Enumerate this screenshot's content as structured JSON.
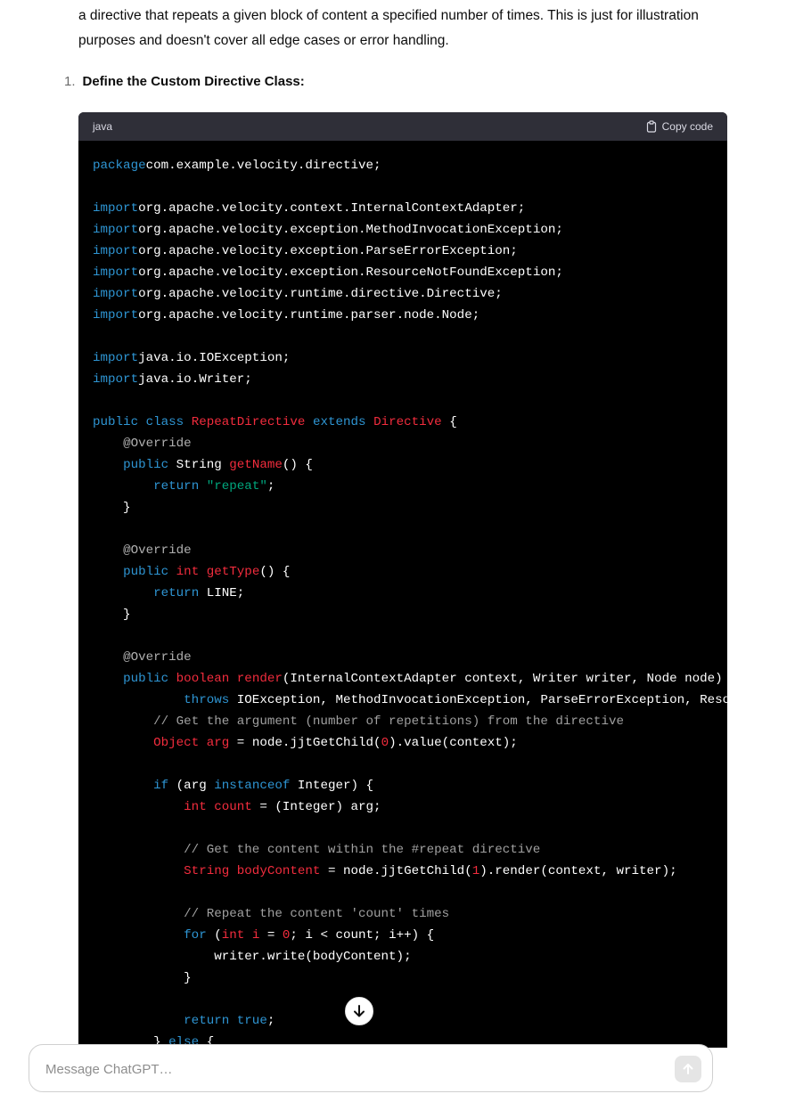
{
  "intro_text": "a directive that repeats a given block of content a specified number of times. This is just for illustration purposes and doesn't cover all edge cases or error handling.",
  "step": {
    "number": "1.",
    "label": "Define the Custom Directive Class:"
  },
  "code_block": {
    "language": "java",
    "copy_label": "Copy code",
    "lines": [
      [
        [
          "kw",
          "package"
        ],
        [
          "",
          "com.example.velocity.directive;"
        ]
      ],
      [],
      [
        [
          "kw",
          "import"
        ],
        [
          "",
          "org.apache.velocity.context.InternalContextAdapter;"
        ]
      ],
      [
        [
          "kw",
          "import"
        ],
        [
          "",
          "org.apache.velocity.exception.MethodInvocationException;"
        ]
      ],
      [
        [
          "kw",
          "import"
        ],
        [
          "",
          "org.apache.velocity.exception.ParseErrorException;"
        ]
      ],
      [
        [
          "kw",
          "import"
        ],
        [
          "",
          "org.apache.velocity.exception.ResourceNotFoundException;"
        ]
      ],
      [
        [
          "kw",
          "import"
        ],
        [
          "",
          "org.apache.velocity.runtime.directive.Directive;"
        ]
      ],
      [
        [
          "kw",
          "import"
        ],
        [
          "",
          "org.apache.velocity.runtime.parser.node.Node;"
        ]
      ],
      [],
      [
        [
          "kw",
          "import"
        ],
        [
          "",
          "java.io.IOException;"
        ]
      ],
      [
        [
          "kw",
          "import"
        ],
        [
          "",
          "java.io.Writer;"
        ]
      ],
      [],
      [
        [
          "kw",
          "public"
        ],
        [
          "",
          " "
        ],
        [
          "kw",
          "class"
        ],
        [
          "",
          " "
        ],
        [
          "ty",
          "RepeatDirective"
        ],
        [
          "",
          " "
        ],
        [
          "kw",
          "extends"
        ],
        [
          "",
          " "
        ],
        [
          "ty",
          "Directive"
        ],
        [
          "",
          " {"
        ]
      ],
      [
        [
          "",
          "    "
        ],
        [
          "an",
          "@Override"
        ]
      ],
      [
        [
          "",
          "    "
        ],
        [
          "kw",
          "public"
        ],
        [
          "",
          " String "
        ],
        [
          "ty",
          "getName"
        ],
        [
          "",
          "() {"
        ]
      ],
      [
        [
          "",
          "        "
        ],
        [
          "kw",
          "return"
        ],
        [
          "",
          " "
        ],
        [
          "str",
          "\"repeat\""
        ],
        [
          "",
          ";"
        ]
      ],
      [
        [
          "",
          "    }"
        ]
      ],
      [],
      [
        [
          "",
          "    "
        ],
        [
          "an",
          "@Override"
        ]
      ],
      [
        [
          "",
          "    "
        ],
        [
          "kw",
          "public"
        ],
        [
          "",
          " "
        ],
        [
          "ty",
          "int"
        ],
        [
          "",
          " "
        ],
        [
          "ty",
          "getType"
        ],
        [
          "",
          "() {"
        ]
      ],
      [
        [
          "",
          "        "
        ],
        [
          "kw",
          "return"
        ],
        [
          "",
          " LINE;"
        ]
      ],
      [
        [
          "",
          "    }"
        ]
      ],
      [],
      [
        [
          "",
          "    "
        ],
        [
          "an",
          "@Override"
        ]
      ],
      [
        [
          "",
          "    "
        ],
        [
          "kw",
          "public"
        ],
        [
          "",
          " "
        ],
        [
          "ty",
          "boolean"
        ],
        [
          "",
          " "
        ],
        [
          "ty",
          "render"
        ],
        [
          "",
          "(InternalContextAdapter context, Writer writer, Node node)"
        ]
      ],
      [
        [
          "",
          "            "
        ],
        [
          "kw",
          "throws"
        ],
        [
          "",
          " IOException, MethodInvocationException, ParseErrorException, ResourceNotFoundException {"
        ]
      ],
      [
        [
          "",
          "        "
        ],
        [
          "cm",
          "// Get the argument (number of repetitions) from the directive"
        ]
      ],
      [
        [
          "",
          "        "
        ],
        [
          "ty",
          "Object"
        ],
        [
          "",
          " "
        ],
        [
          "ty",
          "arg"
        ],
        [
          "",
          " = node.jjtGetChild("
        ],
        [
          "ty",
          "0"
        ],
        [
          "",
          ").value(context);"
        ]
      ],
      [],
      [
        [
          "",
          "        "
        ],
        [
          "kw",
          "if"
        ],
        [
          "",
          " (arg "
        ],
        [
          "kw",
          "instanceof"
        ],
        [
          "",
          " Integer) {"
        ]
      ],
      [
        [
          "",
          "            "
        ],
        [
          "ty",
          "int"
        ],
        [
          "",
          " "
        ],
        [
          "ty",
          "count"
        ],
        [
          "",
          " = (Integer) arg;"
        ]
      ],
      [],
      [
        [
          "",
          "            "
        ],
        [
          "cm",
          "// Get the content within the #repeat directive"
        ]
      ],
      [
        [
          "",
          "            "
        ],
        [
          "ty",
          "String"
        ],
        [
          "",
          " "
        ],
        [
          "ty",
          "bodyContent"
        ],
        [
          "",
          " = node.jjtGetChild("
        ],
        [
          "ty",
          "1"
        ],
        [
          "",
          ").render(context, writer);"
        ]
      ],
      [],
      [
        [
          "",
          "            "
        ],
        [
          "cm",
          "// Repeat the content 'count' times"
        ]
      ],
      [
        [
          "",
          "            "
        ],
        [
          "kw",
          "for"
        ],
        [
          "",
          " ("
        ],
        [
          "ty",
          "int"
        ],
        [
          "",
          " "
        ],
        [
          "ty",
          "i"
        ],
        [
          "",
          " = "
        ],
        [
          "ty",
          "0"
        ],
        [
          "",
          "; i < count; i++) {"
        ]
      ],
      [
        [
          "",
          "                writer.write(bodyContent);"
        ]
      ],
      [
        [
          "",
          "            }"
        ]
      ],
      [],
      [
        [
          "",
          "            "
        ],
        [
          "kw",
          "return"
        ],
        [
          "",
          " "
        ],
        [
          "kw",
          "true"
        ],
        [
          "",
          ";"
        ]
      ],
      [
        [
          "",
          "        } "
        ],
        [
          "kw",
          "else"
        ],
        [
          "",
          " {"
        ]
      ]
    ]
  },
  "composer": {
    "placeholder": "Message ChatGPT…"
  },
  "icons": {
    "copy": "clipboard-icon",
    "scroll": "arrow-down-icon",
    "send": "arrow-up-icon"
  }
}
